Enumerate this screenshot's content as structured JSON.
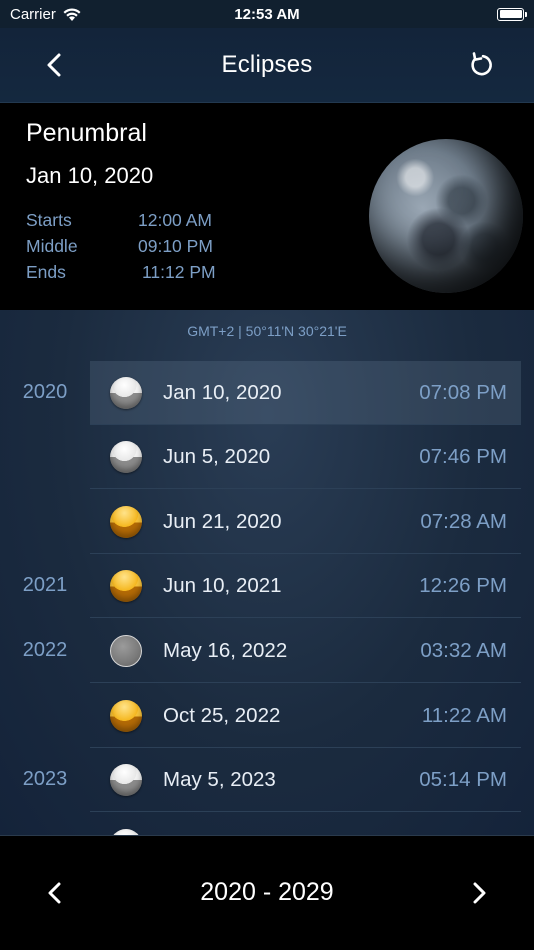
{
  "status": {
    "carrier": "Carrier",
    "time": "12:53 AM"
  },
  "nav": {
    "title": "Eclipses",
    "back_icon": "chevron-left-icon",
    "refresh_icon": "refresh-icon"
  },
  "detail": {
    "type": "Penumbral",
    "date": "Jan 10, 2020",
    "times": [
      {
        "label": "Starts",
        "value": "12:00 AM"
      },
      {
        "label": "Middle",
        "value": "09:10 PM"
      },
      {
        "label": "Ends",
        "value": "11:12 PM"
      }
    ]
  },
  "location": "GMT+2 | 50°11'N 30°21'E",
  "eclipses": [
    {
      "year": "2020",
      "date": "Jan 10, 2020",
      "time": "07:08 PM",
      "kind": "partial",
      "selected": true
    },
    {
      "year": "",
      "date": "Jun 5, 2020",
      "time": "07:46 PM",
      "kind": "partial",
      "selected": false
    },
    {
      "year": "",
      "date": "Jun 21, 2020",
      "time": "07:28 AM",
      "kind": "total",
      "selected": false
    },
    {
      "year": "2021",
      "date": "Jun 10, 2021",
      "time": "12:26 PM",
      "kind": "total",
      "selected": false
    },
    {
      "year": "2022",
      "date": "May 16, 2022",
      "time": "03:32 AM",
      "kind": "penumbral",
      "selected": false
    },
    {
      "year": "",
      "date": "Oct 25, 2022",
      "time": "11:22 AM",
      "kind": "total",
      "selected": false
    },
    {
      "year": "2023",
      "date": "May 5, 2023",
      "time": "05:14 PM",
      "kind": "partial",
      "selected": false
    }
  ],
  "bottom": {
    "range": "2020 - 2029"
  }
}
